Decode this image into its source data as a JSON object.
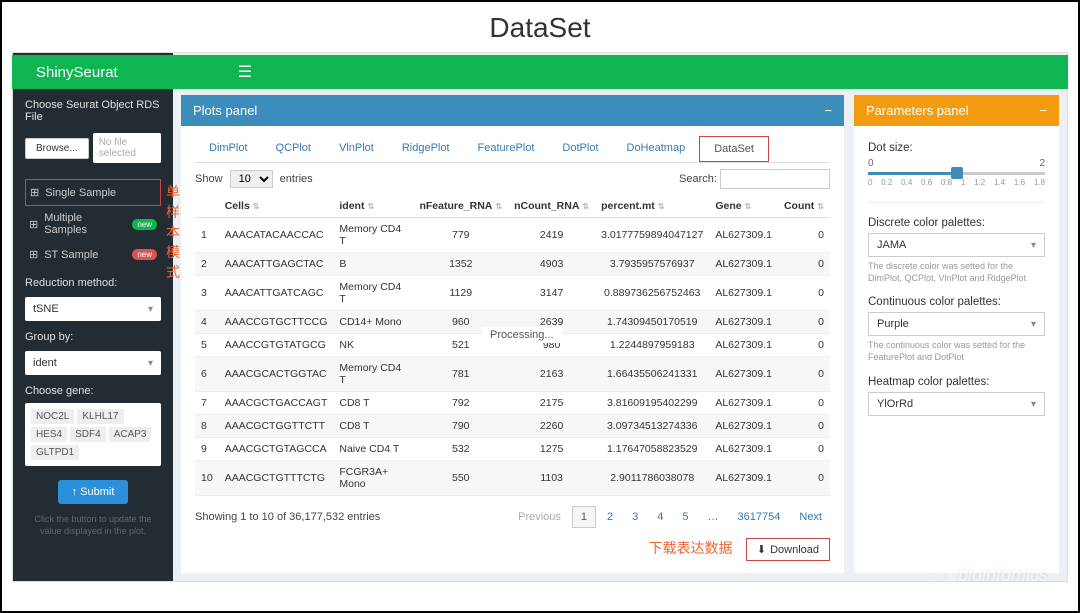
{
  "page_header": "DataSet",
  "topbar": {
    "brand": "ShinySeurat",
    "toggle_icon": "☰"
  },
  "sidebar": {
    "file_label": "Choose Seurat Object RDS File",
    "browse": "Browse...",
    "no_file": "No file selected",
    "nav": [
      {
        "icon": "⊞",
        "label": "Single Sample",
        "boxed": true,
        "anno": "单样本模式"
      },
      {
        "icon": "⊞",
        "label": "Multiple Samples",
        "badge": "new",
        "badge_class": ""
      },
      {
        "icon": "⊞",
        "label": "ST Sample",
        "badge": "new",
        "badge_class": "red"
      }
    ],
    "reduction_label": "Reduction method:",
    "reduction_value": "tSNE",
    "group_label": "Group by:",
    "group_value": "ident",
    "gene_label": "Choose gene:",
    "gene_tags": [
      "NOC2L",
      "KLHL17",
      "HES4",
      "SDF4",
      "ACAP3",
      "GLTPD1"
    ],
    "submit": "↑ Submit",
    "hint": "Click the button to update the value displayed in the plot."
  },
  "plots": {
    "title": "Plots panel",
    "tabs": [
      "DimPlot",
      "QCPlot",
      "VlnPlot",
      "RidgePlot",
      "FeaturePlot",
      "DotPlot",
      "DoHeatmap",
      "DataSet"
    ],
    "active_tab": 7,
    "show_label": "Show",
    "entries_count": "10",
    "entries_suffix": "entries",
    "search_label": "Search:",
    "columns": [
      "",
      "Cells",
      "ident",
      "nFeature_RNA",
      "nCount_RNA",
      "percent.mt",
      "Gene",
      "Count"
    ],
    "rows": [
      [
        "1",
        "AAACATACAACCAC",
        "Memory CD4 T",
        "779",
        "2419",
        "3.0177759894047127",
        "AL627309.1",
        "0"
      ],
      [
        "2",
        "AAACATTGAGCTAC",
        "B",
        "1352",
        "4903",
        "3.7935957576937",
        "AL627309.1",
        "0"
      ],
      [
        "3",
        "AAACATTGATCAGC",
        "Memory CD4 T",
        "1129",
        "3147",
        "0.889736256752463",
        "AL627309.1",
        "0"
      ],
      [
        "4",
        "AAACCGTGCTTCCG",
        "CD14+ Mono",
        "960",
        "2639",
        "1.74309450170519",
        "AL627309.1",
        "0"
      ],
      [
        "5",
        "AAACCGTGTATGCG",
        "NK",
        "521",
        "980",
        "1.2244897959183",
        "AL627309.1",
        "0"
      ],
      [
        "6",
        "AAACGCACTGGTAC",
        "Memory CD4 T",
        "781",
        "2163",
        "1.66435506241331",
        "AL627309.1",
        "0"
      ],
      [
        "7",
        "AAACGCTGACCAGT",
        "CD8 T",
        "792",
        "2175",
        "3.81609195402299",
        "AL627309.1",
        "0"
      ],
      [
        "8",
        "AAACGCTGGTTCTT",
        "CD8 T",
        "790",
        "2260",
        "3.09734513274336",
        "AL627309.1",
        "0"
      ],
      [
        "9",
        "AAACGCTGTAGCCA",
        "Naive CD4 T",
        "532",
        "1275",
        "1.17647058823529",
        "AL627309.1",
        "0"
      ],
      [
        "10",
        "AAACGCTGTTTCTG",
        "FCGR3A+ Mono",
        "550",
        "1103",
        "2.9011786038078",
        "AL627309.1",
        "0"
      ]
    ],
    "processing": "Processing...",
    "info": "Showing 1 to 10 of 36,177,532 entries",
    "prev": "Previous",
    "pages": [
      "1",
      "2",
      "3",
      "4",
      "5",
      "…",
      "3617754"
    ],
    "next": "Next",
    "download": "Download",
    "download_anno": "下载表达数据"
  },
  "params": {
    "title": "Parameters panel",
    "dot_label": "Dot size:",
    "dot_min": "0",
    "dot_max": "2",
    "ticks": [
      "0",
      "0.2",
      "0.4",
      "0.6",
      "0.8",
      "1",
      "1.2",
      "1.4",
      "1.6",
      "1.8"
    ],
    "discrete_label": "Discrete color palettes:",
    "discrete_value": "JAMA",
    "discrete_hint": "The discrete color was setted for the DimPlot, QCPlot, VlnPlot and RidgePlot",
    "continuous_label": "Continuous color palettes:",
    "continuous_value": "Purple",
    "continuous_hint": "The continuous color was setted for the FeaturePlot and DotPlot",
    "heatmap_label": "Heatmap color palettes:",
    "heatmap_value": "YlOrRd"
  },
  "watermark": "bioinfomics"
}
